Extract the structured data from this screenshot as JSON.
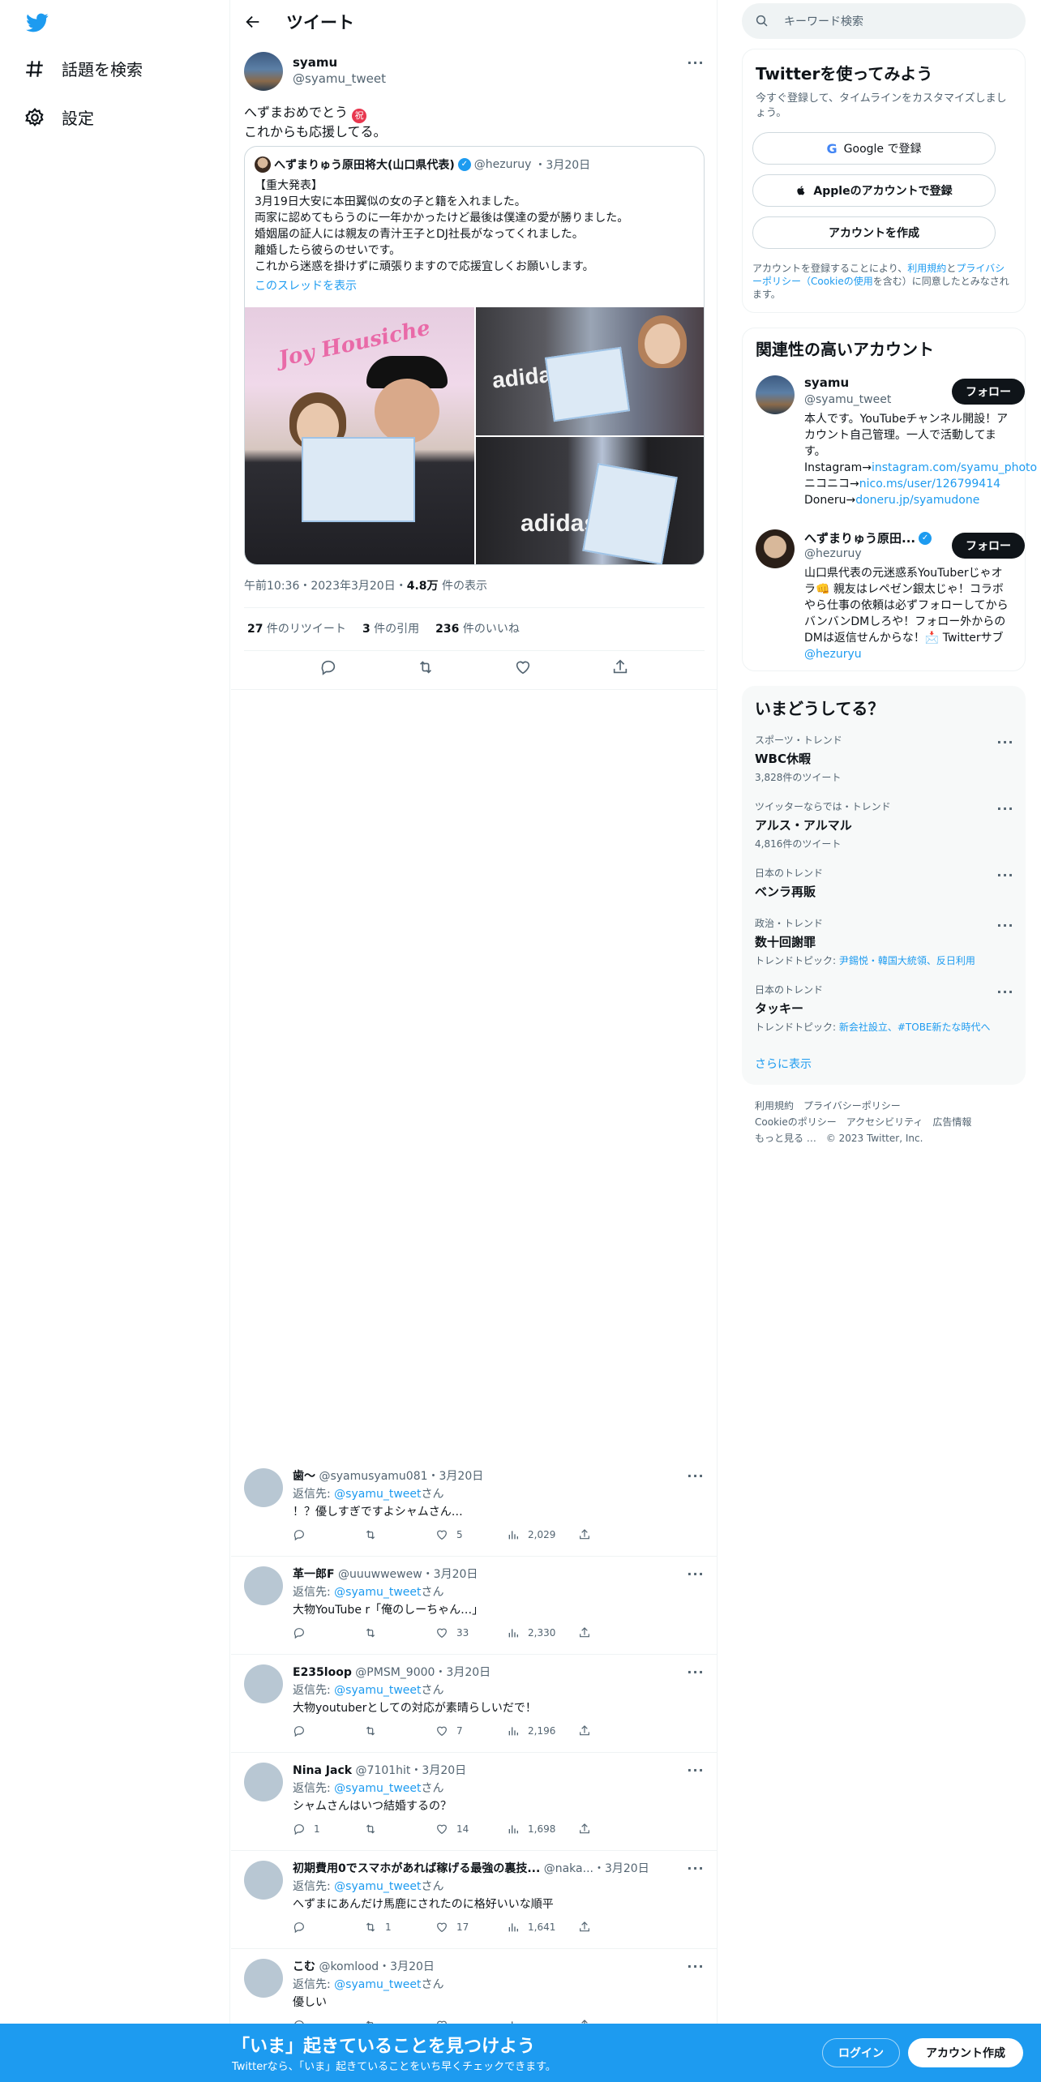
{
  "nav": {
    "items": [
      {
        "label": "話題を検索",
        "icon": "hashtag-icon"
      },
      {
        "label": "設定",
        "icon": "gear-icon"
      }
    ]
  },
  "header": {
    "title": "ツイート"
  },
  "tweet": {
    "name": "syamu",
    "handle": "@syamu_tweet",
    "line1": "へずまおめでとう",
    "line2": "これからも応援してる。",
    "timestamp_pre": "午前10:36・2023年3月20日・",
    "views_count": "4.8万",
    "views_label": " 件の表示",
    "stats": {
      "retweets": "27",
      "retweets_label": " 件のリツイート",
      "quotes": "3",
      "quotes_label": " 件の引用",
      "likes": "236",
      "likes_label": " 件のいいね"
    }
  },
  "quote": {
    "name": "へずまりゅう原田将大(山口県代表)",
    "handle": "@hezuruy",
    "date": "・3月20日",
    "lines": [
      "【重大発表】",
      "3月19日大安に本田翼似の女の子と籍を入れました。",
      "両家に認めてもらうのに一年かかったけど最後は僕達の愛が勝りました。",
      "婚姻届の証人には親友の青汁王子とDJ社長がなってくれました。",
      "離婚したら彼らのせいです。",
      "これから迷惑を掛けずに頑張りますので応援宜しくお願いします。"
    ],
    "thread_link": "このスレッドを表示",
    "photo_logo_text": "Joy Housiche",
    "photo_shirt_text": "adidas"
  },
  "replies": [
    {
      "name": "歯〜",
      "handle": "@syamusyamu081",
      "date": "・3月20日",
      "to_prefix": "返信先: ",
      "to": "@syamu_tweet",
      "to_suffix": "さん",
      "text": "！？優しすぎですよシャムさん…",
      "replies": "",
      "retweets": "",
      "likes": "5",
      "views": "2,029"
    },
    {
      "name": "革一郎F",
      "handle": "@uuuwwewew",
      "date": "・3月20日",
      "to_prefix": "返信先: ",
      "to": "@syamu_tweet",
      "to_suffix": "さん",
      "text": "大物YouTube r「俺のしーちゃん…」",
      "replies": "",
      "retweets": "",
      "likes": "33",
      "views": "2,330"
    },
    {
      "name": "E235loop",
      "handle": "@PMSM_9000",
      "date": "・3月20日",
      "to_prefix": "返信先: ",
      "to": "@syamu_tweet",
      "to_suffix": "さん",
      "text": "大物youtuberとしての対応が素晴らしいだで！",
      "replies": "",
      "retweets": "",
      "likes": "7",
      "views": "2,196"
    },
    {
      "name": "Nina Jack",
      "handle": "@7101hit",
      "date": "・3月20日",
      "to_prefix": "返信先: ",
      "to": "@syamu_tweet",
      "to_suffix": "さん",
      "text": "シャムさんはいつ結婚するの？",
      "replies": "1",
      "retweets": "",
      "likes": "14",
      "views": "1,698"
    },
    {
      "name": "初期費用0でスマホがあれば稼げる最強の裏技...",
      "handle": "@naka...",
      "date": "・3月20日",
      "to_prefix": "返信先: ",
      "to": "@syamu_tweet",
      "to_suffix": "さん",
      "text": "へずまにあんだけ馬鹿にされたのに格好いいな順平",
      "replies": "",
      "retweets": "1",
      "likes": "17",
      "views": "1,641"
    },
    {
      "name": "こむ",
      "handle": "@komlood",
      "date": "・3月20日",
      "to_prefix": "返信先: ",
      "to": "@syamu_tweet",
      "to_suffix": "さん",
      "text": "優しい",
      "replies": "",
      "retweets": "",
      "likes": "",
      "views": ""
    }
  ],
  "search": {
    "placeholder": "キーワード検索"
  },
  "signup": {
    "title": "Twitterを使ってみよう",
    "subtitle": "今すぐ登録して、タイムラインをカスタマイズしましょう。",
    "google": "Google で登録",
    "apple": "Appleのアカウントで登録",
    "create": "アカウントを作成",
    "terms_a": "アカウントを登録することにより、",
    "terms_link1": "利用規約",
    "terms_b": "と",
    "terms_link2": "プライバシーポリシー（Cookieの使用",
    "terms_c": "を含む）に同意したとみなされます。"
  },
  "related": {
    "title": "関連性の高いアカウント",
    "follow_label": "フォロー",
    "accounts": [
      {
        "name": "syamu",
        "handle": "@syamu_tweet",
        "bio_a": "本人です。YouTubeチャンネル開設！アカウント自己管理。一人で活動してます。 Instagram→",
        "bio_link1": "instagram.com/syamu_photo",
        "bio_b": " ニコニコ→",
        "bio_link2": "nico.ms/user/126799414",
        "bio_c": " Doneru→",
        "bio_link3": "doneru.jp/syamudone"
      },
      {
        "name": "へずまりゅう原田...",
        "handle": "@hezuruy",
        "bio_a": "山口県代表の元迷惑系YouTuberじゃオラ👊 親友はレペゼン銀太じゃ！コラボやら仕事の依頼は必ずフォローしてからバンバンDMしろや！フォロー外からのDMは返信せんからな！📩 Twitterサブ",
        "bio_link1": "@hezuryu"
      }
    ]
  },
  "trends": {
    "title": "いまどうしてる？",
    "items": [
      {
        "category": "スポーツ・トレンド",
        "name": "WBC休暇",
        "count": "3,828件のツイート",
        "topics_prefix": "",
        "topics": ""
      },
      {
        "category": "ツイッターならでは・トレンド",
        "name": "アルス・アルマル",
        "count": "4,816件のツイート",
        "topics_prefix": "",
        "topics": ""
      },
      {
        "category": "日本のトレンド",
        "name": "ベンラ再販",
        "count": "",
        "topics_prefix": "",
        "topics": ""
      },
      {
        "category": "政治・トレンド",
        "name": "数十回謝罪",
        "count": "",
        "topics_prefix": "トレンドトピック: ",
        "topics": "尹錫悦・韓国大統領、反日利用"
      },
      {
        "category": "日本のトレンド",
        "name": "タッキー",
        "count": "",
        "topics_prefix": "トレンドトピック: ",
        "topics": "新会社設立、#TOBE新たな時代へ"
      }
    ],
    "more": "さらに表示"
  },
  "footer": {
    "line1": "利用規約　プライバシーポリシー",
    "line2": "Cookieのポリシー　アクセシビリティ　広告情報",
    "line3": "もっと見る …　© 2023 Twitter, Inc."
  },
  "bottombar": {
    "headline": "「いま」起きていることを見つけよう",
    "subline": "Twitterなら、「いま」起きていることをいち早くチェックできます。",
    "login": "ログイン",
    "create": "アカウント作成"
  },
  "colors": {
    "accent": "#1d9bf0",
    "text": "#0f1419",
    "muted": "#536471",
    "border": "#eff3f4"
  }
}
